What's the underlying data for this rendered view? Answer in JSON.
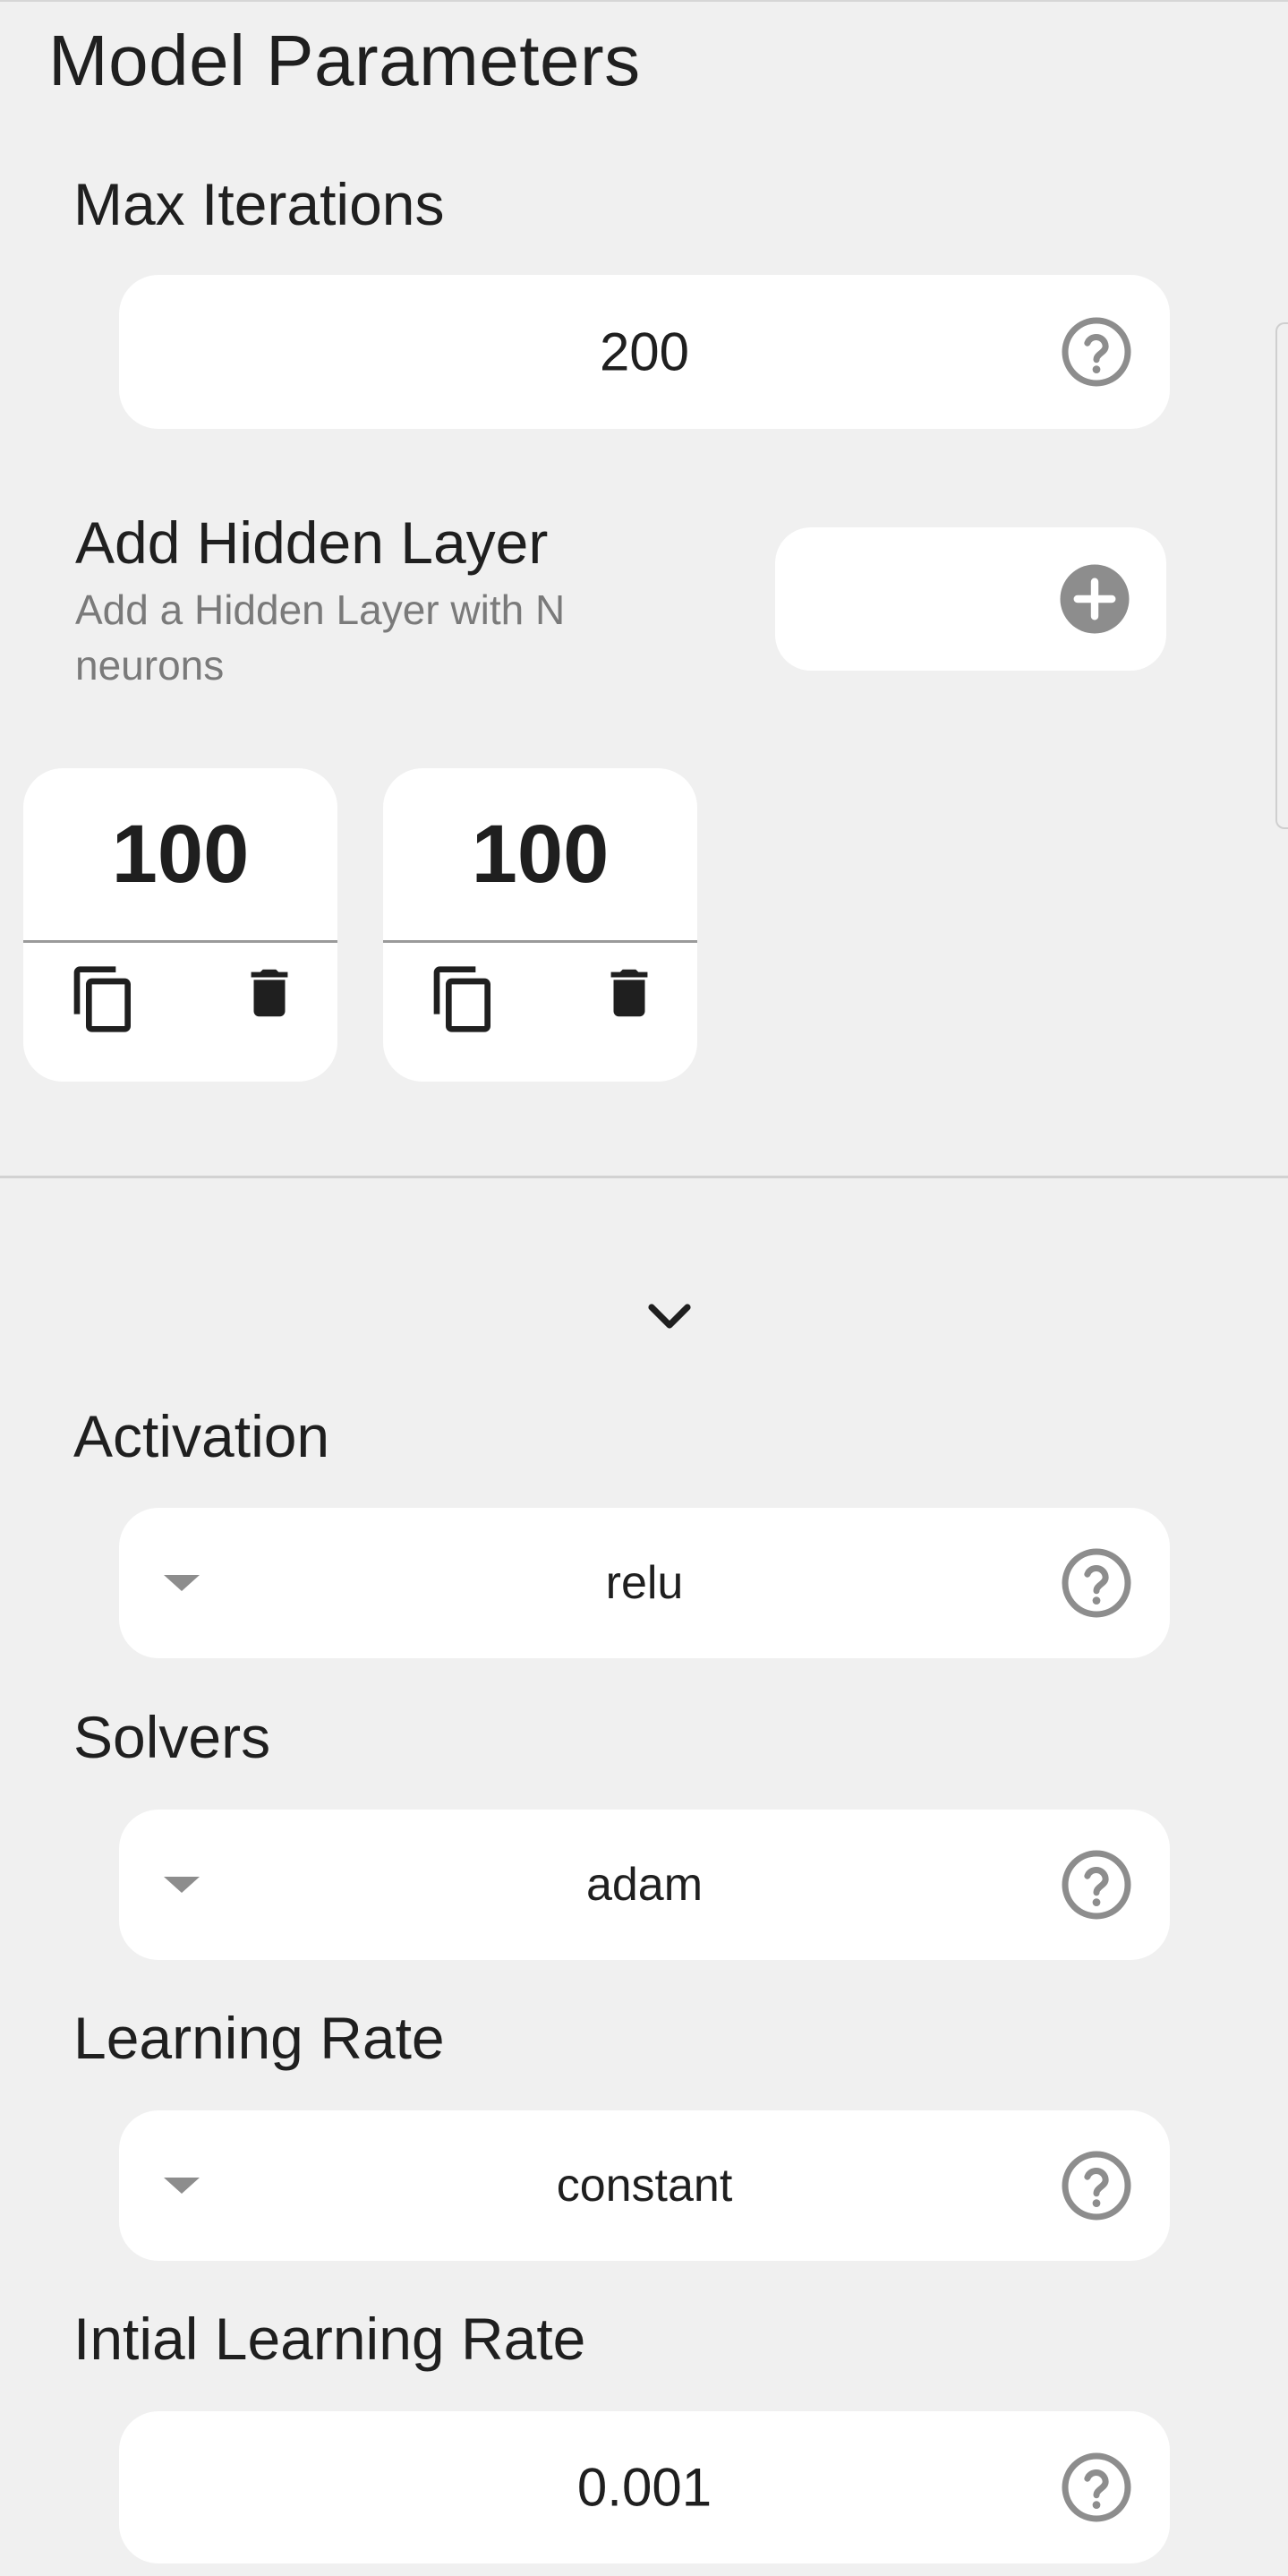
{
  "header": {
    "title": "Model Parameters"
  },
  "max_iterations": {
    "label": "Max Iterations",
    "value": "200"
  },
  "hidden_layer": {
    "title": "Add Hidden Layer",
    "subtitle": "Add a Hidden Layer with N neurons",
    "layers": [
      {
        "neurons": "100"
      },
      {
        "neurons": "100"
      }
    ]
  },
  "activation": {
    "label": "Activation",
    "value": "relu"
  },
  "solvers": {
    "label": "Solvers",
    "value": "adam"
  },
  "learning_rate": {
    "label": "Learning Rate",
    "value": "constant"
  },
  "initial_learning_rate": {
    "label": "Intial Learning Rate",
    "value": "0.001"
  },
  "icons": {
    "help": "help-circle-icon",
    "add": "plus-circle-icon",
    "copy": "copy-icon",
    "delete": "trash-icon",
    "expand": "chevron-down-icon",
    "dropdown": "caret-down-icon"
  },
  "colors": {
    "background": "#f0f0f0",
    "card": "#ffffff",
    "icon_gray": "#8d8d8d",
    "text": "#1f1f1f",
    "subtext": "#7a7a7a"
  }
}
